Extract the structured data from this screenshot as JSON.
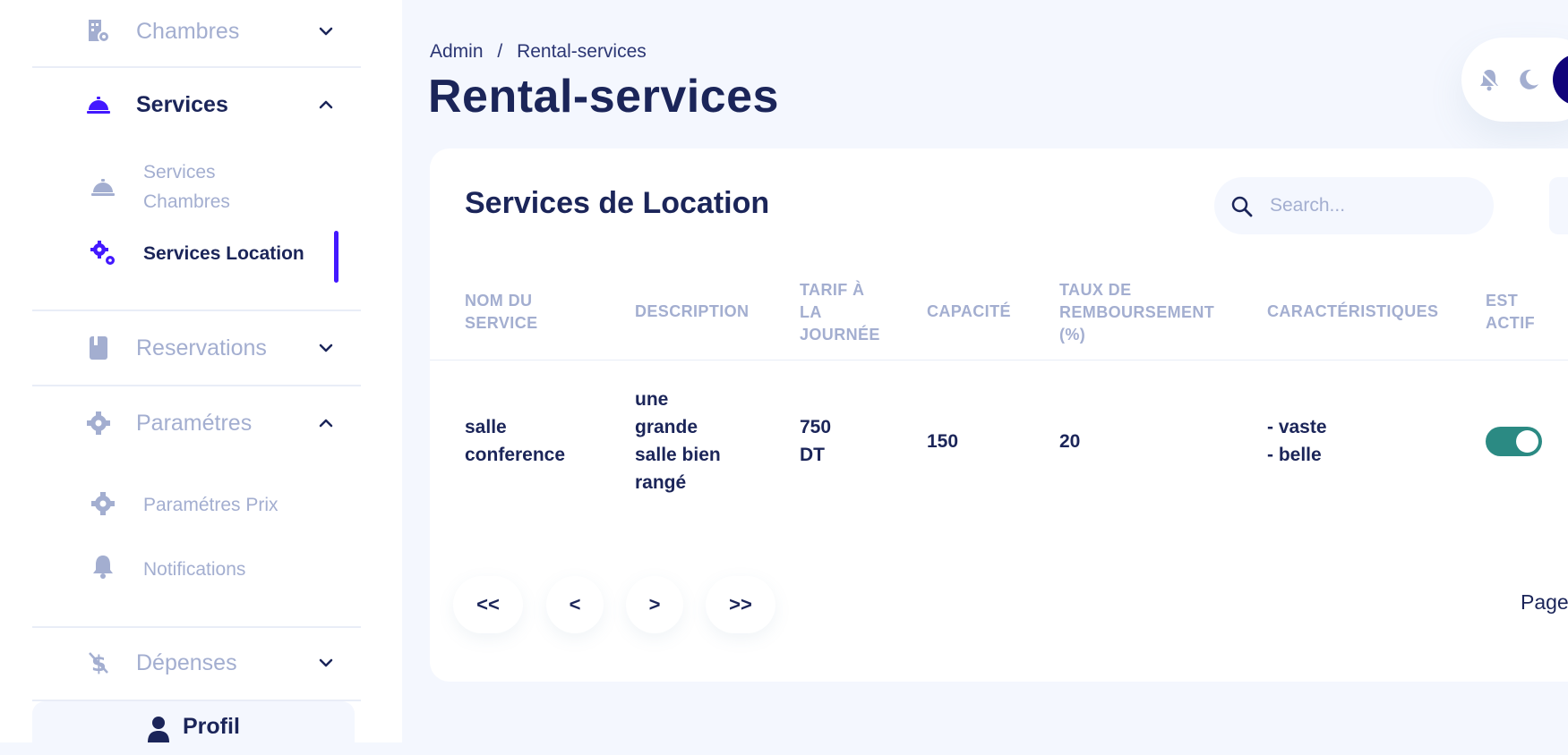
{
  "sidebar": {
    "chambres": "Chambres",
    "services": "Services",
    "services_chambres_line1": "Services",
    "services_chambres_line2": "Chambres",
    "services_location": "Services Location",
    "reservations": "Reservations",
    "parametres": "Paramétres",
    "parametres_prix": "Paramétres Prix",
    "notifications": "Notifications",
    "depenses": "Dépenses",
    "profil": "Profil"
  },
  "header": {
    "breadcrumb_root": "Admin",
    "breadcrumb_sep": "/",
    "breadcrumb_current": "Rental-services",
    "title": "Rental-services"
  },
  "card": {
    "title": "Services de Location",
    "search_placeholder": "Search...",
    "columns": [
      [
        "NOM DU",
        "SERVICE"
      ],
      [
        "DESCRIPTION"
      ],
      [
        "TARIF À",
        "LA",
        "JOURNÉE"
      ],
      [
        "CAPACITÉ"
      ],
      [
        "TAUX DE",
        "REMBOURSEMENT",
        "(%)"
      ],
      [
        "CARACTÉRISTIQUES"
      ],
      [
        "EST",
        "ACTIF"
      ]
    ],
    "row": {
      "name": [
        "salle",
        "conference"
      ],
      "description": [
        "une",
        "grande",
        "salle bien",
        "rangé"
      ],
      "tarif": [
        "750",
        "DT"
      ],
      "capacite": "150",
      "taux": "20",
      "caracteristiques": [
        "- vaste",
        "- belle"
      ],
      "est_actif": true
    },
    "pagination": {
      "first": "<<",
      "prev": "<",
      "next": ">",
      "last": ">>",
      "page_label": "Page"
    }
  },
  "colors": {
    "accent": "#4318ff",
    "navy": "#1b2559",
    "muted": "#a3aed0",
    "toggle_on": "#2b8a83",
    "avatar": "#11047a"
  },
  "icons": {
    "chambres": "building-gear-icon",
    "services": "cloche-icon",
    "services_location": "gears-icon",
    "reservations": "book-icon",
    "parametres": "gear-icon",
    "notifications": "bell-icon",
    "depenses": "dollar-slash-icon",
    "profil": "user-icon",
    "search": "search-icon",
    "alerts": "bell-slash-icon",
    "theme": "moon-icon"
  }
}
